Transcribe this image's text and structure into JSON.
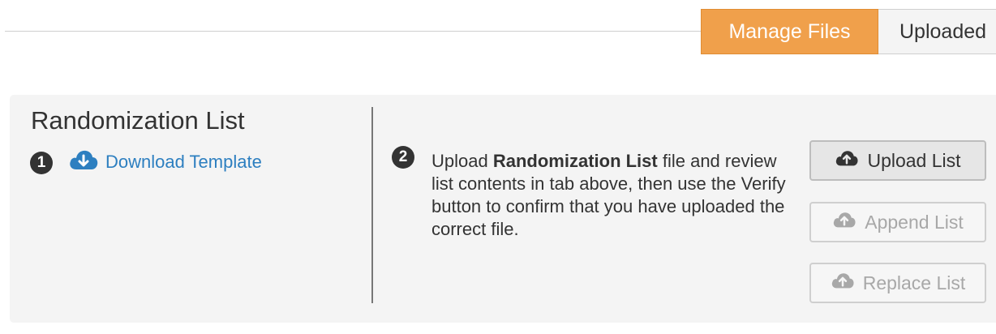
{
  "tabs": {
    "active_label": "Manage Files",
    "inactive_label": "Uploaded"
  },
  "panel": {
    "title": "Randomization List",
    "step1": "1",
    "download_label": "Download Template",
    "step2": "2",
    "instructions": {
      "before": "Upload ",
      "bold": "Randomization List",
      "after": " file and review list contents in tab above, then use the Verify button to confirm that you have uploaded the correct file."
    },
    "buttons": {
      "upload": "Upload List",
      "append": "Append List",
      "replace": "Replace List"
    }
  },
  "colors": {
    "accent": "#f0a04b",
    "link": "#2d7fc0",
    "panel_bg": "#f4f4f4"
  },
  "icons": [
    "cloud-download-icon",
    "cloud-upload-icon"
  ]
}
